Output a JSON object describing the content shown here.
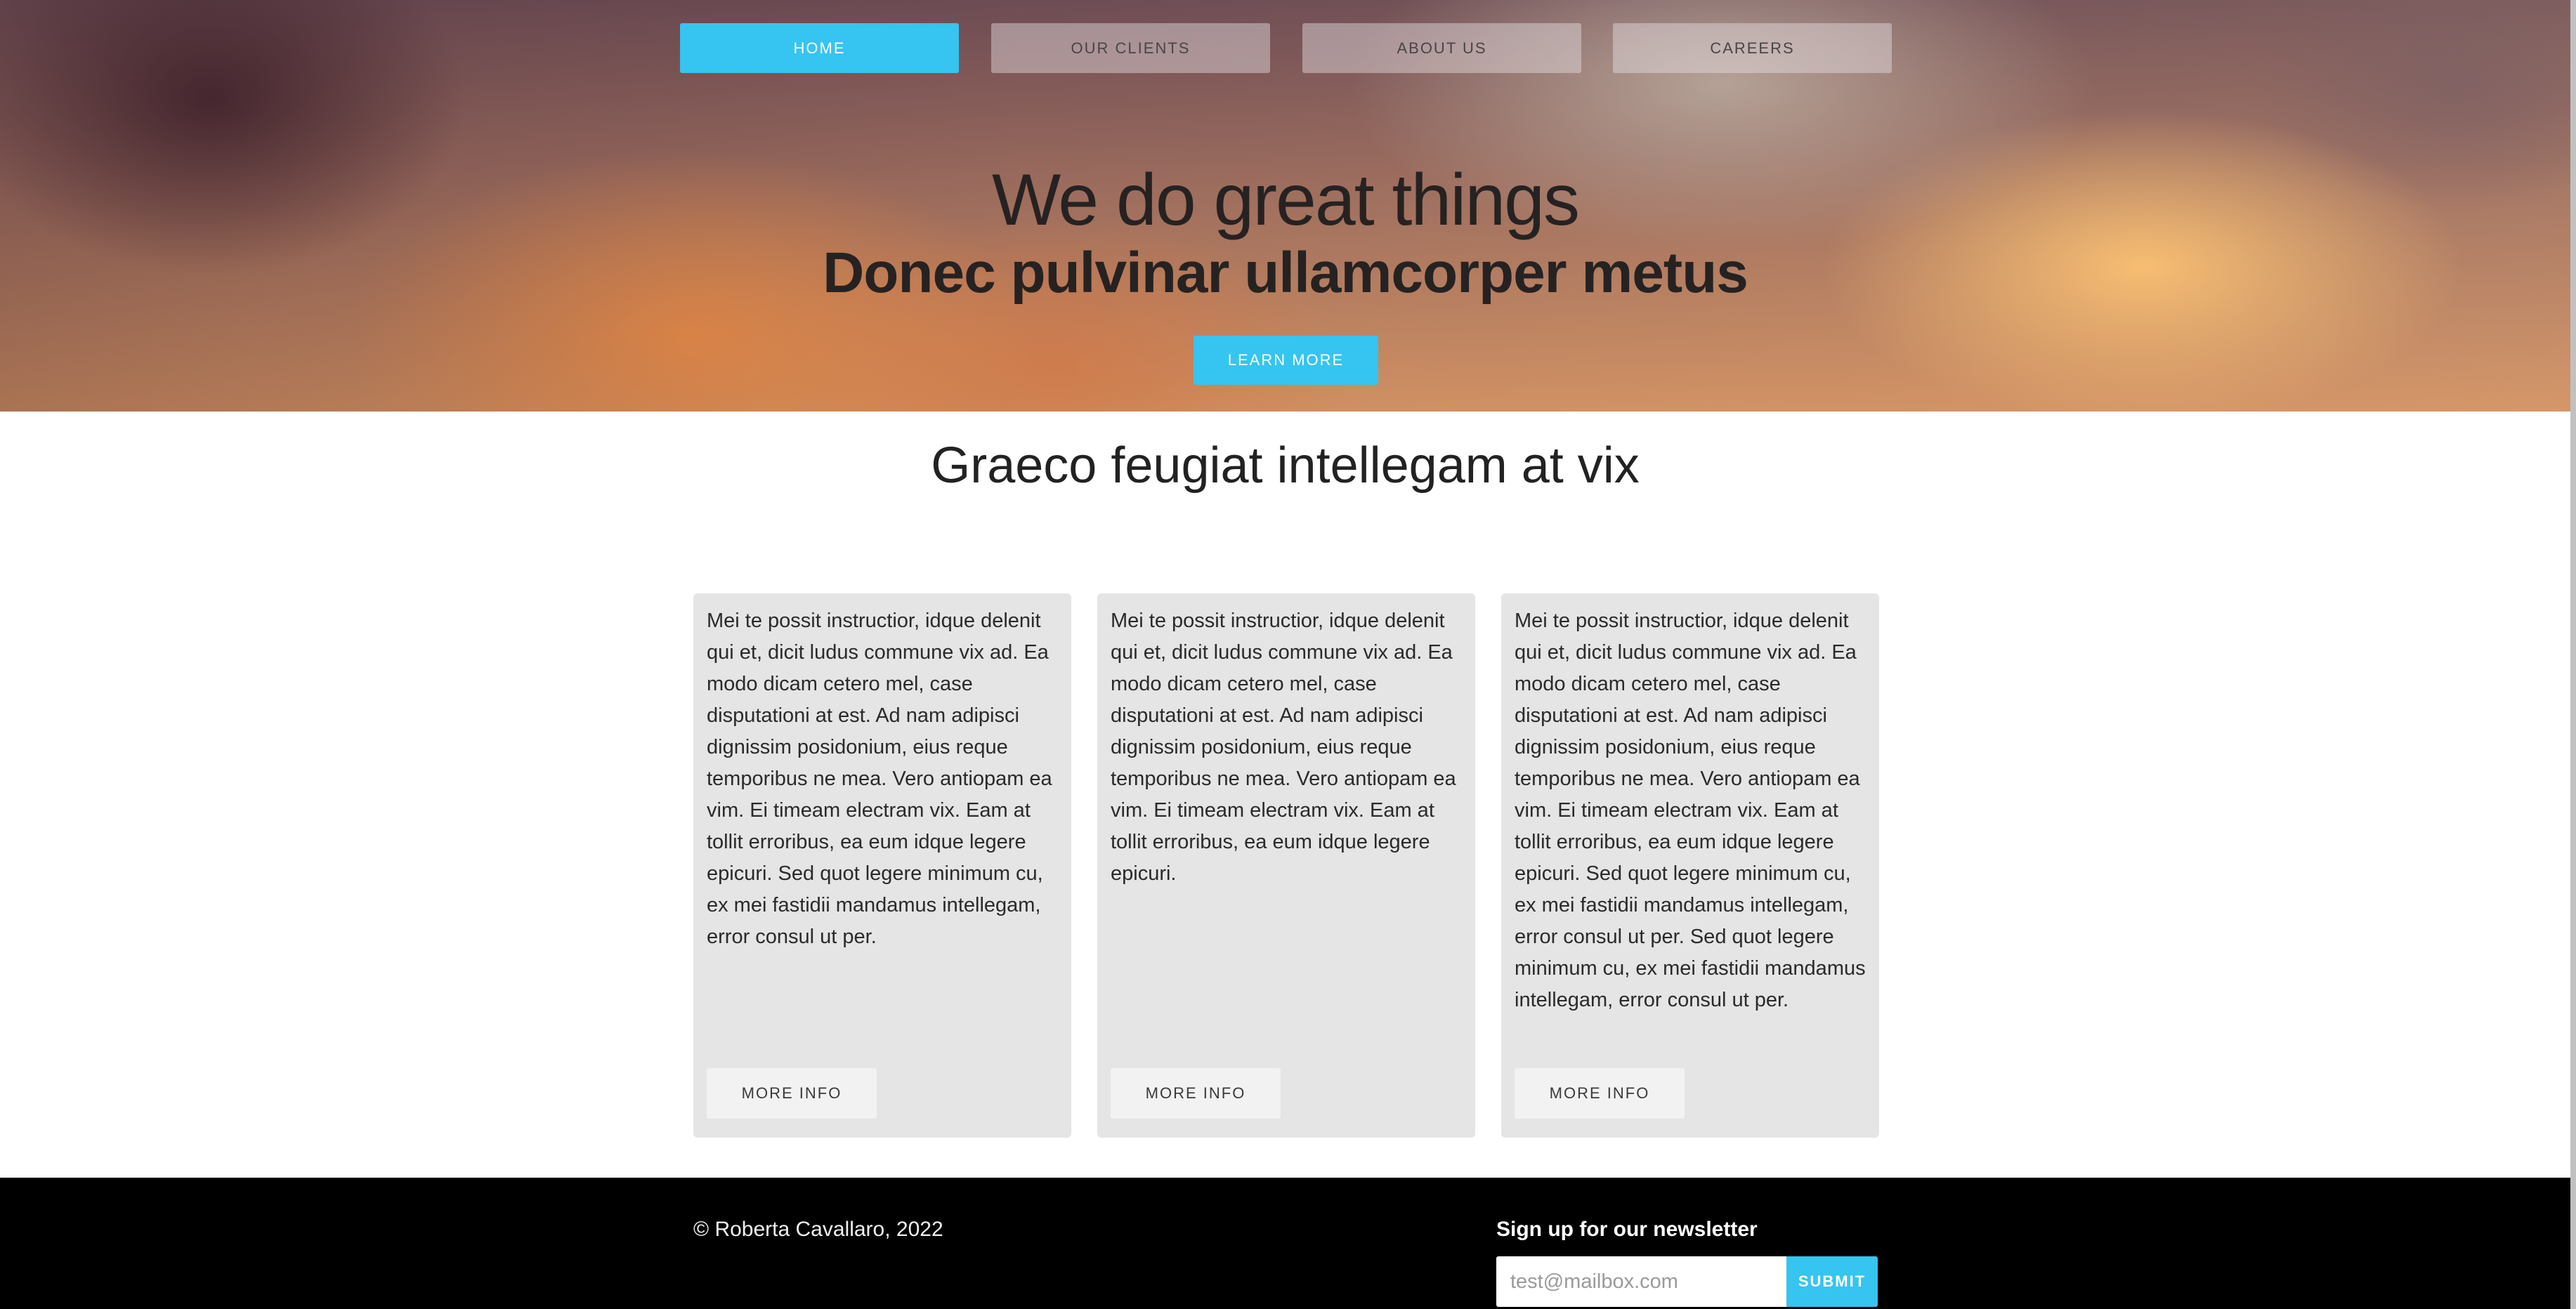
{
  "nav": {
    "items": [
      {
        "label": "HOME",
        "active": true
      },
      {
        "label": "OUR CLIENTS",
        "active": false
      },
      {
        "label": "ABOUT US",
        "active": false
      },
      {
        "label": "CAREERS",
        "active": false
      }
    ]
  },
  "hero": {
    "title": "We do great things",
    "subtitle": "Donec pulvinar ullamcorper metus",
    "cta_label": "LEARN MORE"
  },
  "section": {
    "title": "Graeco feugiat intellegam at vix"
  },
  "cards": [
    {
      "text": "Mei te possit instructior, idque delenit qui et, dicit ludus commune vix ad. Ea modo dicam cetero mel, case disputationi at est. Ad nam adipisci dignissim posidonium, eius reque temporibus ne mea. Vero antiopam ea vim. Ei timeam electram vix. Eam at tollit erroribus, ea eum idque legere epicuri. Sed quot legere minimum cu, ex mei fastidii mandamus intellegam, error consul ut per.",
      "button_label": "MORE INFO"
    },
    {
      "text": "Mei te possit instructior, idque delenit qui et, dicit ludus commune vix ad. Ea modo dicam cetero mel, case disputationi at est. Ad nam adipisci dignissim posidonium, eius reque temporibus ne mea. Vero antiopam ea vim. Ei timeam electram vix. Eam at tollit erroribus, ea eum idque legere epicuri.",
      "button_label": "MORE INFO"
    },
    {
      "text": "Mei te possit instructior, idque delenit qui et, dicit ludus commune vix ad. Ea modo dicam cetero mel, case disputationi at est. Ad nam adipisci dignissim posidonium, eius reque temporibus ne mea. Vero antiopam ea vim. Ei timeam electram vix. Eam at tollit erroribus, ea eum idque legere epicuri. Sed quot legere minimum cu, ex mei fastidii mandamus intellegam, error consul ut per. Sed quot legere minimum cu, ex mei fastidii mandamus intellegam, error consul ut per.",
      "button_label": "MORE INFO"
    }
  ],
  "footer": {
    "copyright": "© Roberta Cavallaro, 2022",
    "newsletter_label": "Sign up for our newsletter",
    "email_placeholder": "test@mailbox.com",
    "submit_label": "SUBMIT"
  },
  "colors": {
    "accent": "#36c4f0",
    "card_bg": "#e5e5e5",
    "footer_bg": "#000000"
  }
}
